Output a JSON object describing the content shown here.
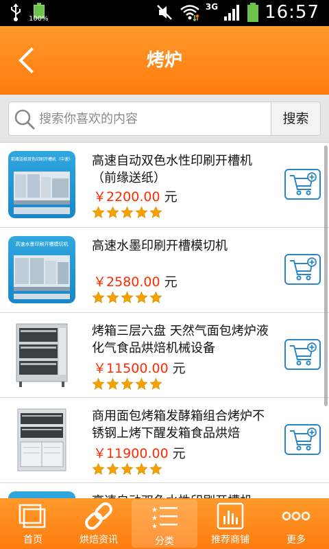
{
  "status_bar": {
    "time": "16:57",
    "network": "3G",
    "battery_small": "100%"
  },
  "header": {
    "title": "烤炉"
  },
  "search": {
    "placeholder": "搜索你喜欢的内容",
    "button_label": "搜索"
  },
  "products": [
    {
      "name": "高速自动双色水性印刷开槽机（前缘送纸）",
      "price": "￥2200.00",
      "unit": "元",
      "rating": 5,
      "thumb_text": "前缘送纸双色印刷开槽机（中速）"
    },
    {
      "name": "高速水墨印刷开槽模切机",
      "price": "￥2580.00",
      "unit": "元",
      "rating": 5,
      "thumb_text": "高速水墨印刷开槽模切机"
    },
    {
      "name": "烤箱三层六盘 天然气面包烤炉液化气食品烘焙机械设备",
      "price": "￥11500.00",
      "unit": "元",
      "rating": 5
    },
    {
      "name": "商用面包烤箱发酵箱组合烤炉不锈钢上烤下醒发箱食品烘焙",
      "price": "￥11900.00",
      "unit": "元",
      "rating": 5
    },
    {
      "name": "高速自动双色水性印刷开槽机"
    }
  ],
  "bottom_nav": [
    {
      "label": "首页",
      "icon": "pages-icon"
    },
    {
      "label": "烘焙资讯",
      "icon": "link-icon"
    },
    {
      "label": "分类",
      "icon": "category-list-icon",
      "active": true
    },
    {
      "label": "推荐商铺",
      "icon": "chart-icon"
    },
    {
      "label": "更多",
      "icon": "more-dots-icon"
    }
  ],
  "colors": {
    "accent": "#ff8a1c",
    "price": "#ff2a00",
    "cart": "#2b86c7",
    "star": "#f5a100"
  }
}
